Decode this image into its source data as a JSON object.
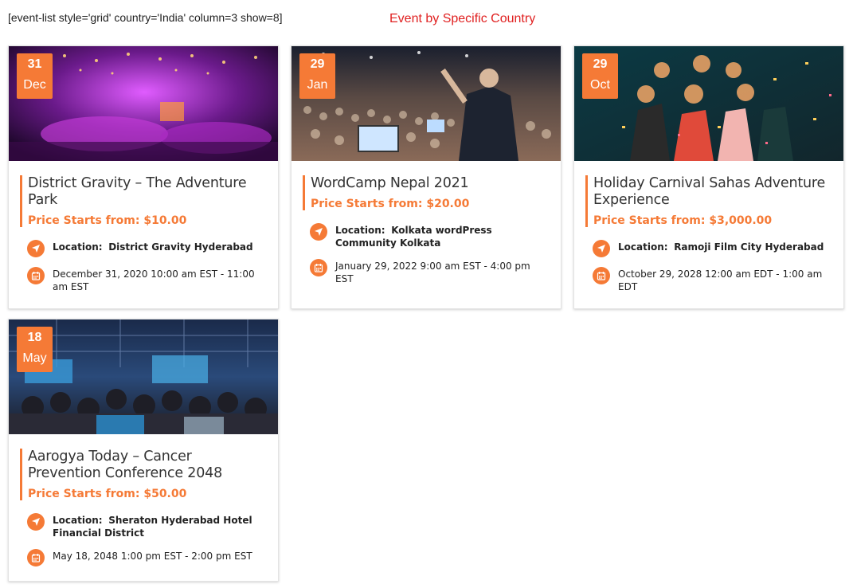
{
  "shortcode_text": "[event-list style='grid' country='India' column=3 show=8]",
  "section_title": "Event by Specific Country",
  "colors": {
    "accent": "#f57a36",
    "title_red": "#e02020"
  },
  "location_label": "Location:",
  "events": [
    {
      "day": "31",
      "month": "Dec",
      "title": "District Gravity – The Adventure Park",
      "price": "Price Starts from: $10.00",
      "location": "District Gravity Hyderabad",
      "datetime": "December 31, 2020  10:00 am EST - 11:00 am EST"
    },
    {
      "day": "29",
      "month": "Jan",
      "title": "WordCamp Nepal 2021",
      "price": "Price Starts from: $20.00",
      "location": "Kolkata wordPress Community Kolkata",
      "datetime": "January 29, 2022  9:00 am EST - 4:00 pm EST"
    },
    {
      "day": "29",
      "month": "Oct",
      "title": "Holiday Carnival Sahas Adventure Experience",
      "price": "Price Starts from: $3,000.00",
      "location": "Ramoji Film City Hyderabad",
      "datetime": "October 29, 2028  12:00 am EDT - 1:00 am EDT"
    },
    {
      "day": "18",
      "month": "May",
      "title": "Aarogya Today – Cancer Prevention Conference 2048",
      "price": "Price Starts from: $50.00",
      "location": "Sheraton Hyderabad Hotel Financial District",
      "datetime": "May 18, 2048  1:00 pm EST - 2:00 pm EST"
    }
  ]
}
